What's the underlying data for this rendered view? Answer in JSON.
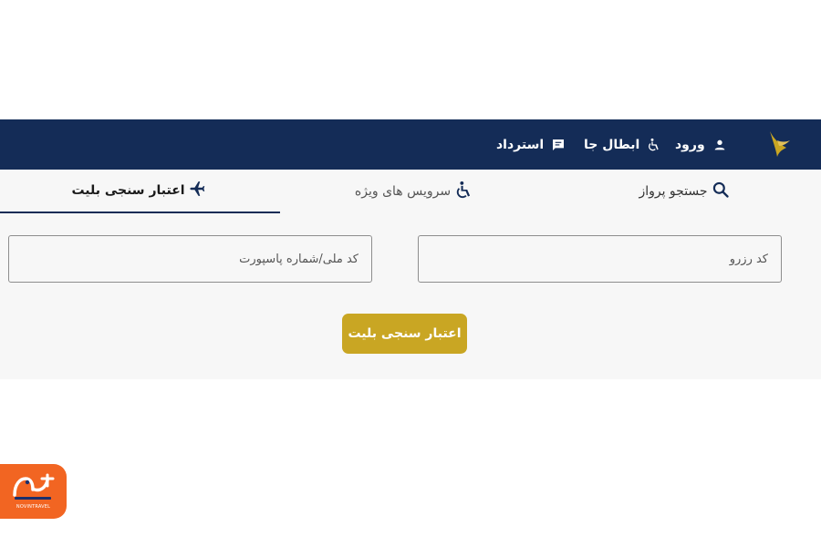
{
  "header": {
    "nav": {
      "login": "ورود",
      "cancel": "ابطال جا",
      "refund": "استرداد"
    },
    "icons": {
      "login": "person-icon",
      "cancel": "wheelchair-person-icon",
      "refund": "chat-message-icon",
      "logo": "bird-wing-logo"
    }
  },
  "tabs": [
    {
      "label": "جستجو پرواز",
      "icon": "search-icon"
    },
    {
      "label": "سرویس های ویژه",
      "icon": "accessible-icon"
    },
    {
      "label": "اعتبار سنجی بلیت",
      "icon": "airplane-icon",
      "active": true
    }
  ],
  "form": {
    "reservation_placeholder": "کد رزرو",
    "national_id_placeholder": "کد ملی/شماره پاسپورت",
    "submit_label": "اعتبار سنجی بلیت"
  },
  "watermark": {
    "brand": "NOVINTRAVEL"
  },
  "colors": {
    "navbar": "#142c57",
    "accent": "#c9a623",
    "panel": "#f7f7f7",
    "watermark": "#f26522"
  }
}
